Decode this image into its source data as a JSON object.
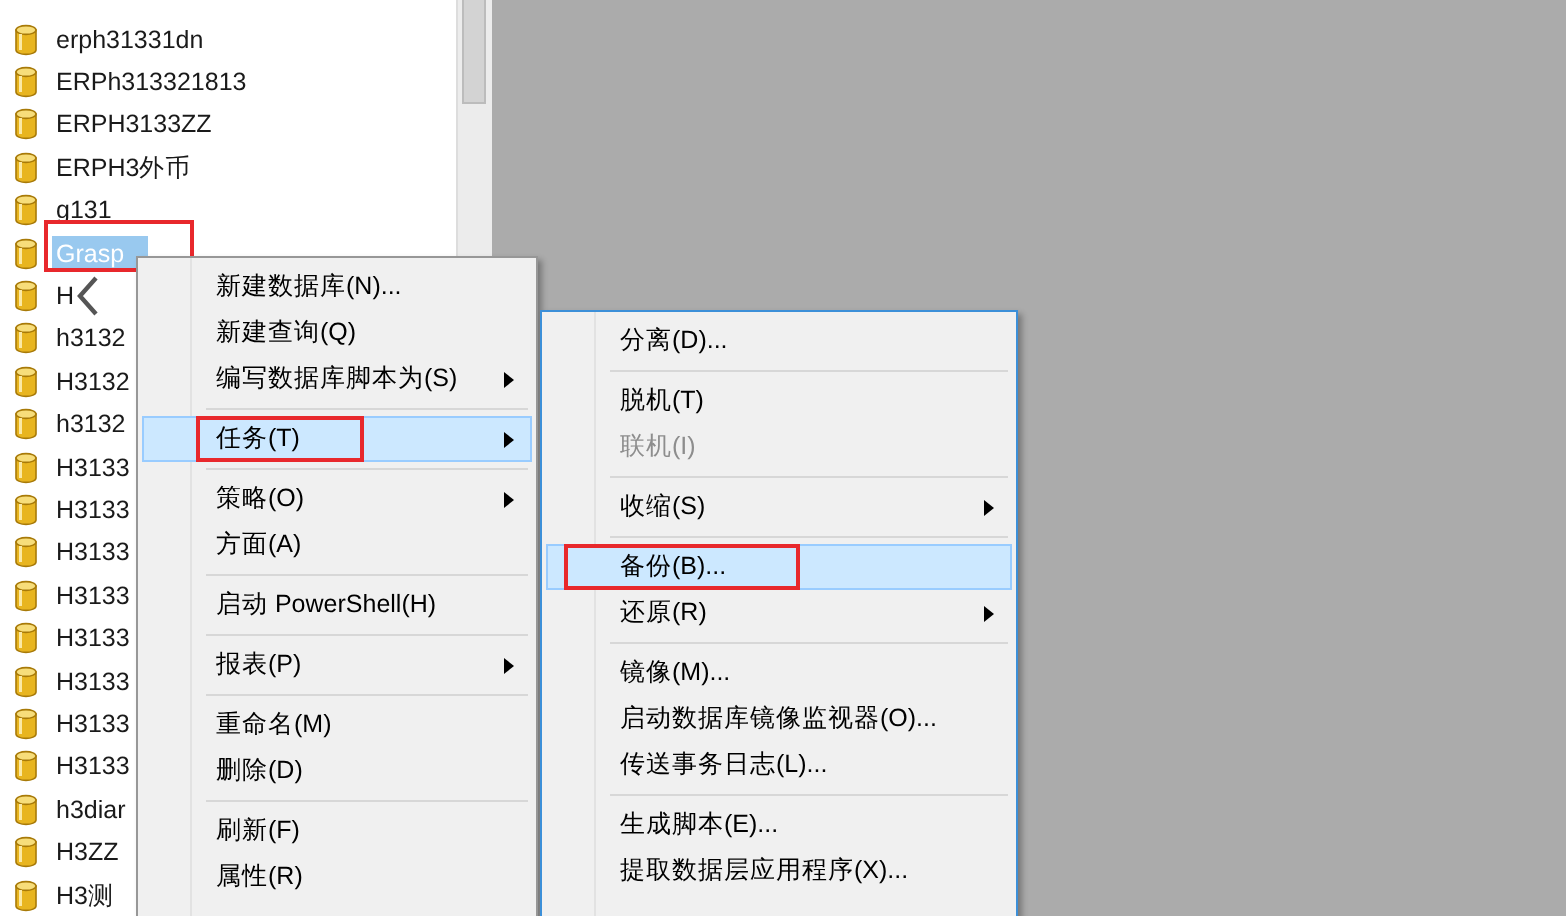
{
  "tree": {
    "items": [
      {
        "label": "erph31331dn",
        "selected": false,
        "annotated": false
      },
      {
        "label": "ERPh313321813",
        "selected": false,
        "annotated": false
      },
      {
        "label": "ERPH3133ZZ",
        "selected": false,
        "annotated": false
      },
      {
        "label": "ERPH3外币",
        "selected": false,
        "annotated": false
      },
      {
        "label": "g131",
        "selected": false,
        "annotated": false
      },
      {
        "label": "Grasp",
        "selected": true,
        "annotated": true
      },
      {
        "label": "H",
        "selected": false,
        "annotated": false,
        "chevron": true
      },
      {
        "label": "h3132",
        "selected": false,
        "annotated": false
      },
      {
        "label": "H3132",
        "selected": false,
        "annotated": false
      },
      {
        "label": "h3132",
        "selected": false,
        "annotated": false
      },
      {
        "label": "H3133",
        "selected": false,
        "annotated": false
      },
      {
        "label": "H3133",
        "selected": false,
        "annotated": false
      },
      {
        "label": "H3133",
        "selected": false,
        "annotated": false
      },
      {
        "label": "H3133",
        "selected": false,
        "annotated": false
      },
      {
        "label": "H3133",
        "selected": false,
        "annotated": false
      },
      {
        "label": "H3133",
        "selected": false,
        "annotated": false
      },
      {
        "label": "H3133",
        "selected": false,
        "annotated": false
      },
      {
        "label": "H3133",
        "selected": false,
        "annotated": false
      },
      {
        "label": "h3diar",
        "selected": false,
        "annotated": false
      },
      {
        "label": "H3ZZ",
        "selected": false,
        "annotated": false
      },
      {
        "label": "H3测",
        "selected": false,
        "annotated": false
      }
    ]
  },
  "context_menu": {
    "items": [
      {
        "kind": "item",
        "label": "新建数据库(N)...",
        "submenu": false,
        "selected": false,
        "disabled": false,
        "annotated": false
      },
      {
        "kind": "item",
        "label": "新建查询(Q)",
        "submenu": false,
        "selected": false,
        "disabled": false,
        "annotated": false
      },
      {
        "kind": "item",
        "label": "编写数据库脚本为(S)",
        "submenu": true,
        "selected": false,
        "disabled": false,
        "annotated": false
      },
      {
        "kind": "separator"
      },
      {
        "kind": "item",
        "label": "任务(T)",
        "submenu": true,
        "selected": true,
        "disabled": false,
        "annotated": true
      },
      {
        "kind": "separator"
      },
      {
        "kind": "item",
        "label": "策略(O)",
        "submenu": true,
        "selected": false,
        "disabled": false,
        "annotated": false
      },
      {
        "kind": "item",
        "label": "方面(A)",
        "submenu": false,
        "selected": false,
        "disabled": false,
        "annotated": false
      },
      {
        "kind": "separator"
      },
      {
        "kind": "item",
        "label": "启动 PowerShell(H)",
        "submenu": false,
        "selected": false,
        "disabled": false,
        "annotated": false
      },
      {
        "kind": "separator"
      },
      {
        "kind": "item",
        "label": "报表(P)",
        "submenu": true,
        "selected": false,
        "disabled": false,
        "annotated": false
      },
      {
        "kind": "separator"
      },
      {
        "kind": "item",
        "label": "重命名(M)",
        "submenu": false,
        "selected": false,
        "disabled": false,
        "annotated": false
      },
      {
        "kind": "item",
        "label": "删除(D)",
        "submenu": false,
        "selected": false,
        "disabled": false,
        "annotated": false
      },
      {
        "kind": "separator"
      },
      {
        "kind": "item",
        "label": "刷新(F)",
        "submenu": false,
        "selected": false,
        "disabled": false,
        "annotated": false
      },
      {
        "kind": "item",
        "label": "属性(R)",
        "submenu": false,
        "selected": false,
        "disabled": false,
        "annotated": false
      }
    ]
  },
  "submenu": {
    "items": [
      {
        "kind": "item",
        "label": "分离(D)...",
        "submenu": false,
        "selected": false,
        "disabled": false,
        "annotated": false
      },
      {
        "kind": "separator"
      },
      {
        "kind": "item",
        "label": "脱机(T)",
        "submenu": false,
        "selected": false,
        "disabled": false,
        "annotated": false
      },
      {
        "kind": "item",
        "label": "联机(I)",
        "submenu": false,
        "selected": false,
        "disabled": true,
        "annotated": false
      },
      {
        "kind": "separator"
      },
      {
        "kind": "item",
        "label": "收缩(S)",
        "submenu": true,
        "selected": false,
        "disabled": false,
        "annotated": false
      },
      {
        "kind": "separator"
      },
      {
        "kind": "item",
        "label": "备份(B)...",
        "submenu": false,
        "selected": true,
        "disabled": false,
        "annotated": true
      },
      {
        "kind": "item",
        "label": "还原(R)",
        "submenu": true,
        "selected": false,
        "disabled": false,
        "annotated": false
      },
      {
        "kind": "separator"
      },
      {
        "kind": "item",
        "label": "镜像(M)...",
        "submenu": false,
        "selected": false,
        "disabled": false,
        "annotated": false
      },
      {
        "kind": "item",
        "label": "启动数据库镜像监视器(O)...",
        "submenu": false,
        "selected": false,
        "disabled": false,
        "annotated": false
      },
      {
        "kind": "item",
        "label": "传送事务日志(L)...",
        "submenu": false,
        "selected": false,
        "disabled": false,
        "annotated": false
      },
      {
        "kind": "separator"
      },
      {
        "kind": "item",
        "label": "生成脚本(E)...",
        "submenu": false,
        "selected": false,
        "disabled": false,
        "annotated": false
      },
      {
        "kind": "item",
        "label": "提取数据层应用程序(X)...",
        "submenu": false,
        "selected": false,
        "disabled": false,
        "annotated": false
      }
    ]
  }
}
